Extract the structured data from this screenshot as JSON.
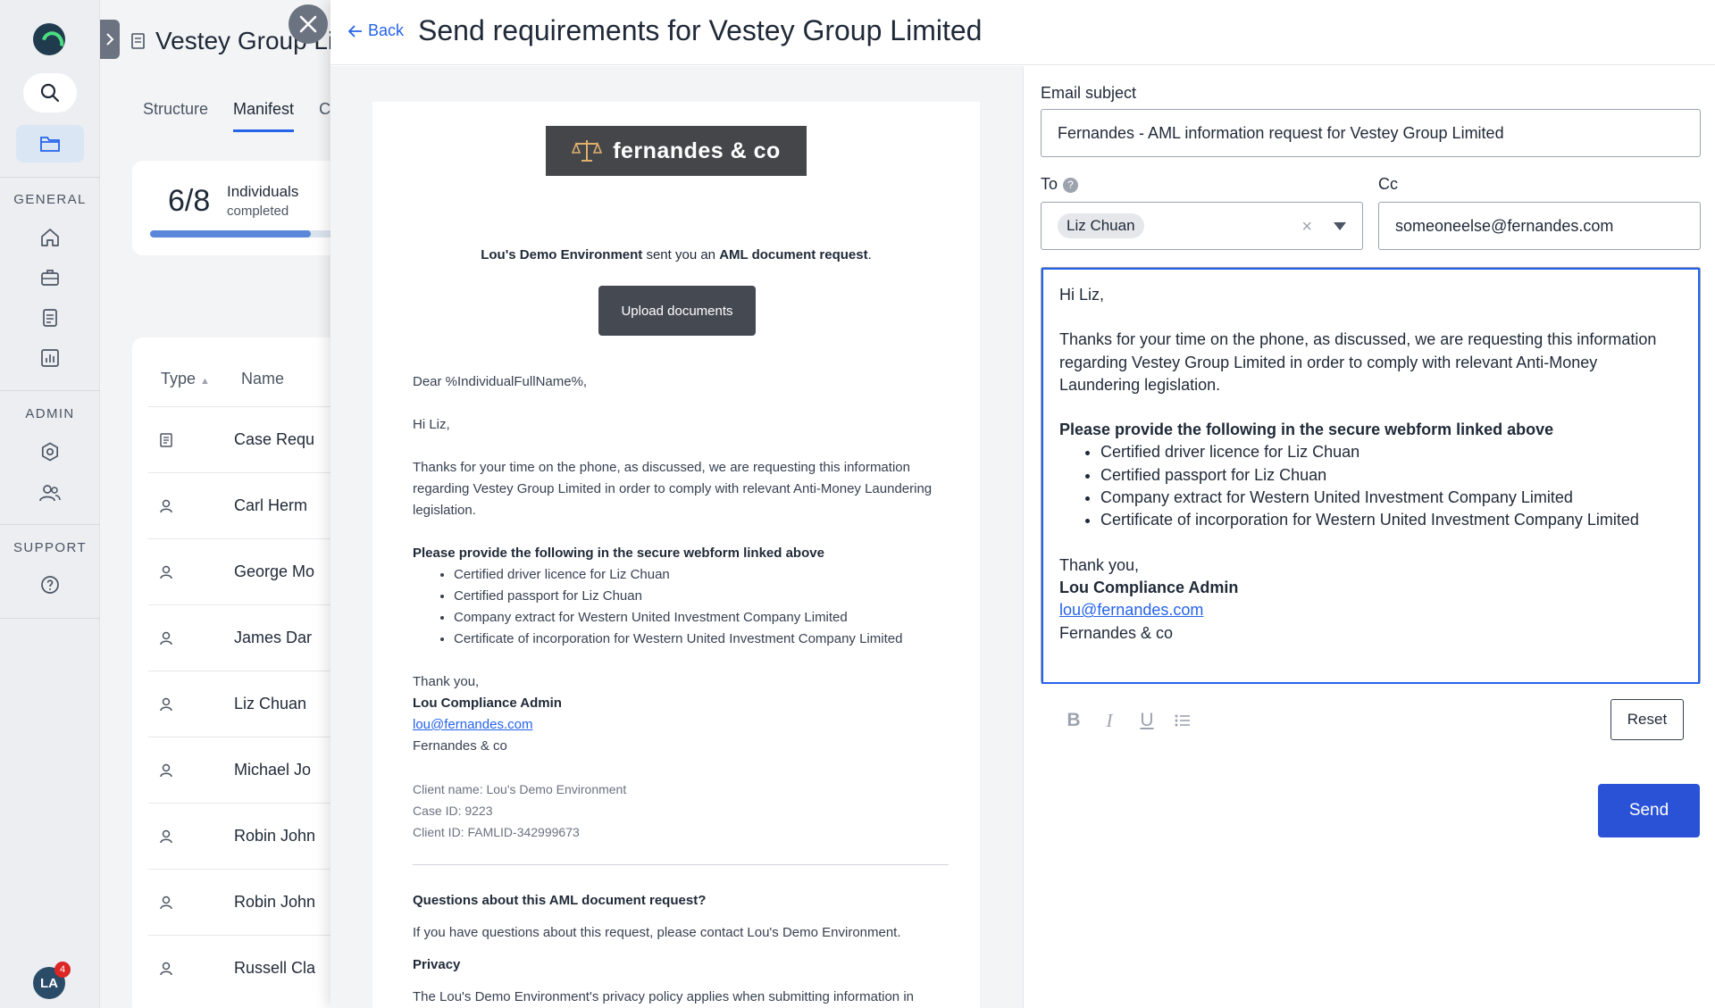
{
  "rail": {
    "sections": {
      "general": "GENERAL",
      "admin": "ADMIN",
      "support": "SUPPORT"
    },
    "avatar_initials": "LA",
    "notification_count": "4"
  },
  "background_page": {
    "title": "Vestey Group Li",
    "tabs": [
      "Structure",
      "Manifest",
      "C"
    ],
    "progress": {
      "count": "6/8",
      "label": "Individuals",
      "sublabel": "completed",
      "fraction": 0.75
    },
    "table": {
      "headers": {
        "type": "Type",
        "name": "Name"
      },
      "rows": [
        "Case Requ",
        "Carl Herm",
        "George Mo",
        "James Dar",
        "Liz Chuan",
        "Michael Jo",
        "Robin John",
        "Robin John",
        "Russell Cla"
      ]
    }
  },
  "modal": {
    "back_label": "Back",
    "title": "Send requirements for Vestey Group Limited",
    "preview": {
      "brand": "fernandes & co",
      "intro": {
        "sender": "Lou's Demo Environment",
        "middle": " sent you an ",
        "kind": "AML document request",
        "end": "."
      },
      "upload_button": "Upload documents",
      "greeting_template": "Dear %IndividualFullName%,",
      "greeting": "Hi Liz,",
      "paragraph": "Thanks for your time on the phone, as discussed, we are requesting this information regarding Vestey Group Limited in order to comply with relevant Anti-Money Laundering legislation.",
      "list_heading": "Please provide the following in the secure webform linked above",
      "items": [
        "Certified driver licence for Liz Chuan",
        "Certified passport for Liz Chuan",
        "Company extract for Western United Investment Company Limited",
        "Certificate of incorporation for Western United Investment Company Limited"
      ],
      "signoff": "Thank you,",
      "signer": "Lou Compliance Admin",
      "email": "lou@fernandes.com",
      "company": "Fernandes & co",
      "client_name": "Client name: Lou's Demo Environment",
      "case_id": "Case ID: 9223",
      "client_id": "Client ID: FAMLID-342999673",
      "questions_heading": "Questions about this AML document request?",
      "questions_text": "If you have questions about this request, please contact Lou's Demo Environment.",
      "privacy_heading": "Privacy",
      "privacy_text": "The Lou's Demo Environment's privacy policy applies when submitting information in response to this request."
    },
    "form": {
      "subject_label": "Email subject",
      "subject_value": "Fernandes - AML information request for Vestey Group Limited",
      "to_label": "To",
      "to_chip": "Liz Chuan",
      "cc_label": "Cc",
      "cc_value": "someoneelse@fernandes.com",
      "body": {
        "greeting": "Hi Liz,",
        "paragraph": "Thanks for your time on the phone, as discussed, we are requesting this information regarding Vestey Group Limited in order to comply with relevant Anti-Money Laundering legislation.",
        "list_heading": "Please provide the following in the secure webform linked above",
        "items": [
          "Certified driver licence for Liz Chuan",
          "Certified passport for Liz Chuan",
          "Company extract for Western United Investment Company Limited",
          "Certificate of incorporation for Western United Investment Company Limited"
        ],
        "signoff": "Thank you,",
        "signer": "Lou Compliance Admin",
        "email": "lou@fernandes.com",
        "company": "Fernandes & co"
      },
      "toolbar": {
        "bold": "B",
        "italic": "I",
        "underline": "U"
      },
      "reset_label": "Reset",
      "send_label": "Send"
    }
  },
  "colors": {
    "accent": "#2952d6",
    "link": "#2563eb",
    "brand_banner": "#44464a",
    "progress": "#5b87db"
  }
}
